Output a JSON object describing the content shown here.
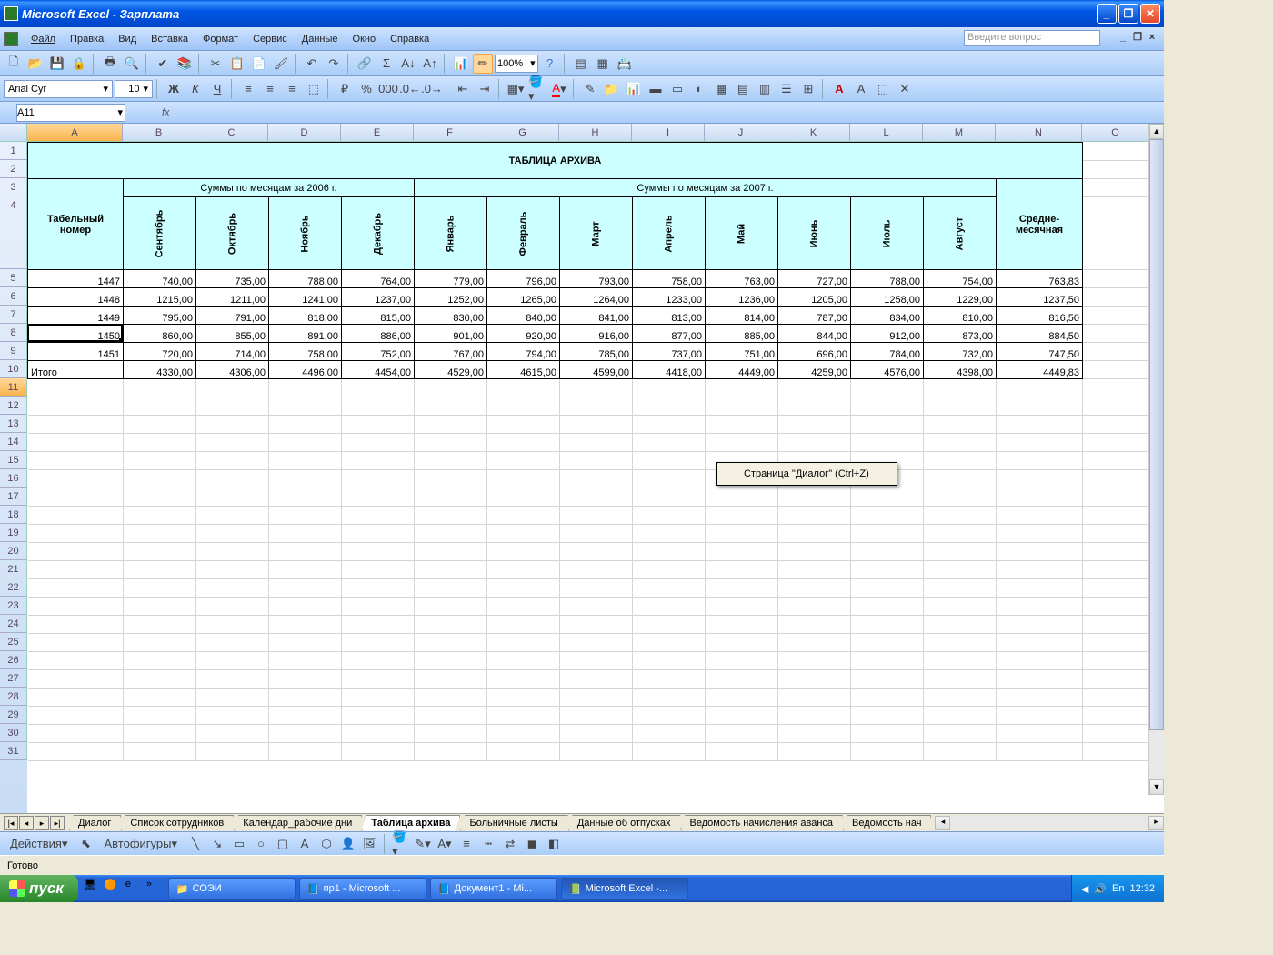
{
  "window": {
    "title": "Microsoft Excel - Зарплата"
  },
  "menu": {
    "file": "Файл",
    "edit": "Правка",
    "view": "Вид",
    "insert": "Вставка",
    "format": "Формат",
    "tools": "Сервис",
    "data": "Данные",
    "window": "Окно",
    "help": "Справка",
    "ask": "Введите вопрос"
  },
  "toolbar": {
    "zoom": "100%"
  },
  "format": {
    "font": "Arial Cyr",
    "size": "10"
  },
  "namebox": {
    "ref": "A11",
    "fx": "fx"
  },
  "columns": [
    "A",
    "B",
    "C",
    "D",
    "E",
    "F",
    "G",
    "H",
    "I",
    "J",
    "K",
    "L",
    "M",
    "N",
    "O"
  ],
  "rows_shown": 31,
  "table": {
    "title": "ТАБЛИЦА АРХИВА",
    "group2006": "Суммы по месяцам за 2006 г.",
    "group2007": "Суммы по месяцам за 2007 г.",
    "id_header": "Табельный номер",
    "avg_header": "Средне-месячная",
    "months": [
      "Сентябрь",
      "Октябрь",
      "Ноябрь",
      "Декабрь",
      "Январь",
      "Февраль",
      "Март",
      "Апрель",
      "Май",
      "Июнь",
      "Июль",
      "Август"
    ],
    "rows": [
      {
        "id": "1447",
        "v": [
          "740,00",
          "735,00",
          "788,00",
          "764,00",
          "779,00",
          "796,00",
          "793,00",
          "758,00",
          "763,00",
          "727,00",
          "788,00",
          "754,00"
        ],
        "avg": "763,83"
      },
      {
        "id": "1448",
        "v": [
          "1215,00",
          "1211,00",
          "1241,00",
          "1237,00",
          "1252,00",
          "1265,00",
          "1264,00",
          "1233,00",
          "1236,00",
          "1205,00",
          "1258,00",
          "1229,00"
        ],
        "avg": "1237,50"
      },
      {
        "id": "1449",
        "v": [
          "795,00",
          "791,00",
          "818,00",
          "815,00",
          "830,00",
          "840,00",
          "841,00",
          "813,00",
          "814,00",
          "787,00",
          "834,00",
          "810,00"
        ],
        "avg": "816,50"
      },
      {
        "id": "1450",
        "v": [
          "860,00",
          "855,00",
          "891,00",
          "886,00",
          "901,00",
          "920,00",
          "916,00",
          "877,00",
          "885,00",
          "844,00",
          "912,00",
          "873,00"
        ],
        "avg": "884,50"
      },
      {
        "id": "1451",
        "v": [
          "720,00",
          "714,00",
          "758,00",
          "752,00",
          "767,00",
          "794,00",
          "785,00",
          "737,00",
          "751,00",
          "696,00",
          "784,00",
          "732,00"
        ],
        "avg": "747,50"
      }
    ],
    "total_label": "Итого",
    "totals": [
      "4330,00",
      "4306,00",
      "4496,00",
      "4454,00",
      "4529,00",
      "4615,00",
      "4599,00",
      "4418,00",
      "4449,00",
      "4259,00",
      "4576,00",
      "4398,00"
    ],
    "total_avg": "4449,83"
  },
  "tooltip": "Страница \"Диалог\" (Ctrl+Z)",
  "tabs": {
    "nav": [
      "|◂",
      "◂",
      "▸",
      "▸|"
    ],
    "items": [
      "Диалог",
      "Список сотрудников",
      "Календар_рабочие дни",
      "Таблица архива",
      "Больничные листы",
      "Данные об отпусках",
      "Ведомость начисления аванса",
      "Ведомость нач"
    ],
    "active_index": 3
  },
  "draw": {
    "actions": "Действия",
    "autoshapes": "Автофигуры"
  },
  "status": {
    "ready": "Готово"
  },
  "taskbar": {
    "start": "пуск",
    "items": [
      {
        "label": "СОЭИ",
        "icon": "folder"
      },
      {
        "label": "пр1 - Microsoft ...",
        "icon": "word"
      },
      {
        "label": "Документ1 - Mi...",
        "icon": "word"
      },
      {
        "label": "Microsoft Excel -...",
        "icon": "excel",
        "active": true
      }
    ],
    "lang": "En",
    "time": "12:32"
  }
}
